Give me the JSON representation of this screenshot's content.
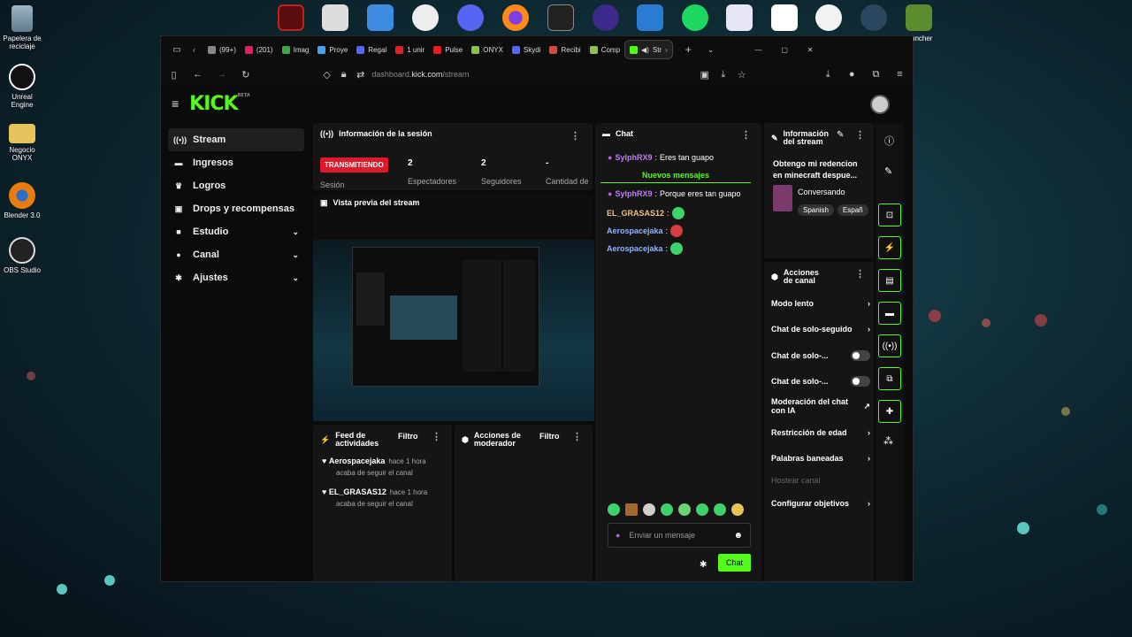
{
  "desktop": {
    "icons": [
      {
        "label": "Papelera de\nreciclaje"
      },
      {
        "label": "Unreal\nEngine"
      },
      {
        "label": "Negocio\nONYX"
      },
      {
        "label": "Blender 3.0"
      },
      {
        "label": "OBS Studio"
      }
    ],
    "launcher_label": "uncher"
  },
  "browser": {
    "tabs": [
      {
        "label": "(99+)"
      },
      {
        "label": "(201)"
      },
      {
        "label": "Imag"
      },
      {
        "label": "Proye"
      },
      {
        "label": "Regal"
      },
      {
        "label": "1 unir"
      },
      {
        "label": "Pulse"
      },
      {
        "label": "ONYX"
      },
      {
        "label": "Skydi"
      },
      {
        "label": "Recibi"
      },
      {
        "label": "Comp"
      },
      {
        "label": "Str"
      }
    ],
    "url_prefix": "dashboard.",
    "url_domain": "kick.com",
    "url_path": "/stream"
  },
  "kick": {
    "logo": "KICK",
    "logo_beta": "BETA",
    "sidebar": [
      {
        "label": "Stream",
        "icon": "broadcast-icon"
      },
      {
        "label": "Ingresos",
        "icon": "money-icon"
      },
      {
        "label": "Logros",
        "icon": "trophy-icon"
      },
      {
        "label": "Drops y recompensas",
        "icon": "gift-icon"
      },
      {
        "label": "Estudio",
        "icon": "video-icon"
      },
      {
        "label": "Canal",
        "icon": "user-icon"
      },
      {
        "label": "Ajustes",
        "icon": "gear-icon"
      }
    ],
    "session": {
      "title": "Información de la sesión",
      "live_badge": "TRANSMITIENDO",
      "session_label": "Sesión",
      "viewers_value": "2",
      "viewers_label": "Espectadores",
      "followers_value": "2",
      "followers_label": "Seguidores",
      "amount_value": "-",
      "amount_label": "Cantidad de"
    },
    "preview": {
      "title": "Vista previa del stream"
    },
    "feed": {
      "title": "Feed de actividades",
      "filter": "Filtro",
      "items": [
        {
          "name": "Aerospacejaka",
          "time": "hace 1 hora",
          "text": "acaba de seguir el canal"
        },
        {
          "name": "EL_GRASAS12",
          "time": "hace 1 hora",
          "text": "acaba de seguir el canal"
        }
      ]
    },
    "mod_actions": {
      "title": "Acciones de moderador",
      "filter": "Filtro"
    },
    "chat": {
      "title": "Chat",
      "messages": [
        {
          "user": "SylphRX9",
          "text": "Eres tan guapo",
          "color": "#c07ef5"
        },
        {
          "divider": "Nuevos mensajes"
        },
        {
          "user": "SylphRX9",
          "text": "Porque eres tan guapo",
          "color": "#c07ef5"
        },
        {
          "user": "EL_GRASAS12",
          "text": "",
          "color": "#f1c27d"
        },
        {
          "user": "Aerospacejaka",
          "text": "",
          "color": "#8fb3ff"
        },
        {
          "user": "Aerospacejaka",
          "text": "",
          "color": "#8fb3ff"
        }
      ],
      "placeholder": "Enviar un mensaje",
      "send_label": "Chat"
    },
    "stream_info": {
      "title": "Información del stream",
      "stream_title": "Obtengo mi redencion en minecraft despue...",
      "category": "Conversando",
      "tags": [
        "Spanish",
        "Españ"
      ]
    },
    "channel_actions": {
      "title": "Acciones de canal",
      "items": [
        {
          "label": "Modo lento",
          "control": "chevron"
        },
        {
          "label": "Chat de solo-seguido",
          "control": "chevron"
        },
        {
          "label": "Chat de solo-...",
          "control": "toggle"
        },
        {
          "label": "Chat de solo-...",
          "control": "toggle"
        },
        {
          "label": "Moderación del chat con IA",
          "control": "external"
        },
        {
          "label": "Restricción de edad",
          "control": "chevron"
        },
        {
          "label": "Palabras baneadas",
          "control": "chevron"
        },
        {
          "label": "Hostear canal",
          "control": "none"
        },
        {
          "label": "Configurar objetivos",
          "control": "chevron"
        }
      ]
    }
  },
  "colors": {
    "accent": "#53fc18",
    "live": "#e0192a"
  }
}
